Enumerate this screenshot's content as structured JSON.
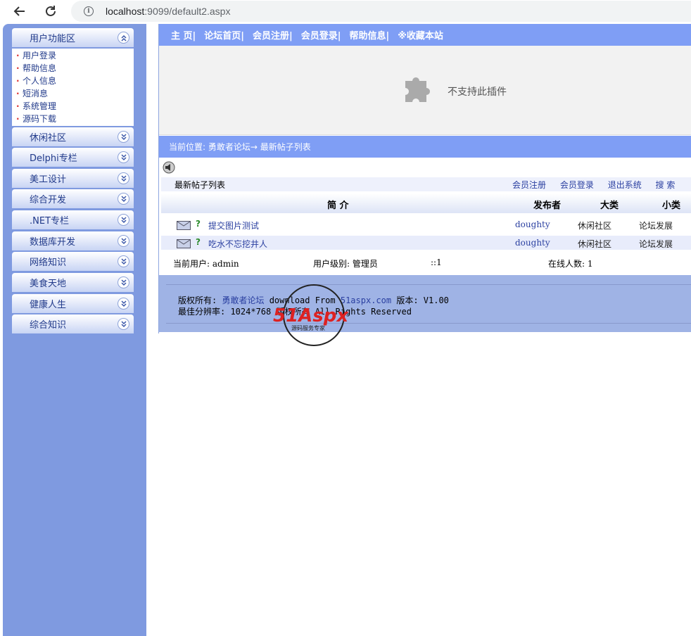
{
  "browser": {
    "url_host": "localhost",
    "url_rest": ":9099/default2.aspx"
  },
  "sidebar": {
    "open_panel": {
      "title": "用户功能区",
      "items": [
        "用户登录",
        "帮助信息",
        "个人信息",
        "短消息",
        "系统管理",
        "源码下载"
      ]
    },
    "panels": [
      "休闲社区",
      "Delphi专栏",
      "美工设计",
      "综合开发",
      ".NET专栏",
      "数据库开发",
      "网络知识",
      "美食天地",
      "健康人生",
      "综合知识"
    ]
  },
  "topnav": [
    "主 页|",
    "论坛首页|",
    "会员注册|",
    "会员登录|",
    "帮助信息|",
    "※收藏本站"
  ],
  "plugin": {
    "message": "不支持此插件"
  },
  "location": {
    "text": "当前位置: 勇敢者论坛→ 最新帖子列表"
  },
  "list": {
    "title": "最新帖子列表",
    "links": [
      "会员注册",
      "会员登录",
      "退出系统",
      "搜 索"
    ],
    "columns": {
      "intro": "简 介",
      "author": "发布者",
      "category": "大类",
      "subcategory": "小类"
    },
    "rows": [
      {
        "q": "?",
        "title": "提交图片测试",
        "author": "doughty",
        "category": "休闲社区",
        "subcategory": "论坛发展"
      },
      {
        "q": "?",
        "title": "吃水不忘挖井人",
        "author": "doughty",
        "category": "休闲社区",
        "subcategory": "论坛发展"
      }
    ]
  },
  "status": {
    "user": "当前用户: admin",
    "level": "用户级别: 管理员",
    "sep": "::1",
    "online": "在线人数: 1"
  },
  "footer": {
    "copyright_label": "版权所有: ",
    "copyright_link": "勇敢者论坛",
    "download_label": " download From ",
    "download_link": "51aspx.com",
    "version": " 版本: V1.00",
    "resolution": "最佳分辨率: 1024*768 版权所有 All Rights Reserved"
  },
  "watermark": {
    "brand": "51Aspx",
    "tagline": "源码服务专家"
  },
  "colors": {
    "nav_blue": "#7f9ef5",
    "sidebar_blue": "#7f9ae0",
    "link_blue": "#2a3fa0",
    "footer_blue": "#9fb3e5"
  }
}
